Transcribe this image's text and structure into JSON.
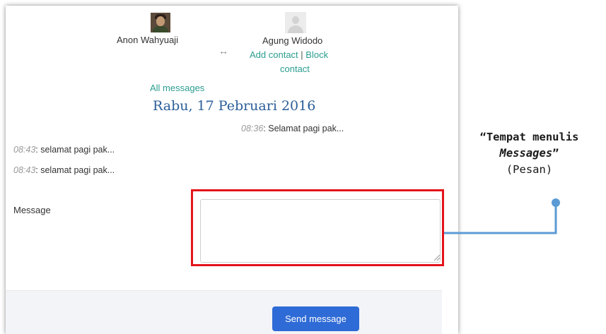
{
  "header": {
    "sender_name": "Anon Wahyuaji",
    "recipient_name": "Agung Widodo",
    "swap_icon": "↔",
    "add_contact": "Add contact",
    "separator": "|",
    "block_contact_part1": "Block",
    "block_contact_part2": "contact"
  },
  "all_messages_link": "All messages",
  "date_heading": "Rabu, 17 Pebruari 2016",
  "messages": [
    {
      "time": "08:36",
      "text": ": Selamat pagi pak..."
    },
    {
      "time": "08:43",
      "text": ": selamat pagi pak..."
    },
    {
      "time": "08:43",
      "text": ": selamat pagi pak..."
    }
  ],
  "form": {
    "message_label": "Message",
    "message_value": "",
    "send_button": "Send message"
  },
  "annotation": {
    "line1": "“Tempat menulis",
    "line2_italic": "Messages",
    "line2_quote": "”",
    "line3": "(Pesan)"
  },
  "colors": {
    "highlight": "#e4141b",
    "connector": "#5b9bd5",
    "link": "#2a9d8f",
    "heading": "#2b5f99",
    "button": "#2f6bd6"
  }
}
